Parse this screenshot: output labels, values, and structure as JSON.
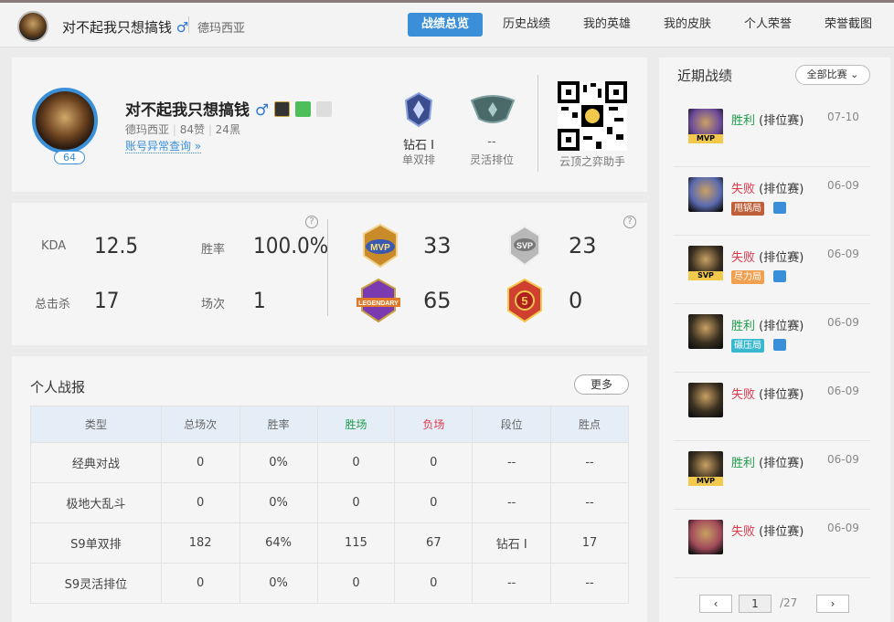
{
  "header": {
    "nickname": "对不起我只想搞钱",
    "gender_symbol": "♂",
    "region": "德玛西亚",
    "tabs": [
      {
        "label": "战绩总览",
        "active": true
      },
      {
        "label": "历史战绩",
        "active": false
      },
      {
        "label": "我的英雄",
        "active": false
      },
      {
        "label": "我的皮肤",
        "active": false
      },
      {
        "label": "个人荣誉",
        "active": false
      },
      {
        "label": "荣誉截图",
        "active": false
      }
    ]
  },
  "profile": {
    "name": "对不起我只想搞钱",
    "gender_symbol": "♂",
    "level": "64",
    "region": "德玛西亚",
    "likes": "84赞",
    "blacks": "24黑",
    "abnormal_link": "账号异常查询 »",
    "solo_rank": "钻石 Ⅰ",
    "solo_label": "单双排",
    "flex_rank": "--",
    "flex_label": "灵活排位",
    "qr_caption": "云顶之弈助手"
  },
  "stats": {
    "kda_label": "KDA",
    "kda": "12.5",
    "winrate_label": "胜率",
    "winrate": "100.0%",
    "kills_label": "总击杀",
    "kills": "17",
    "games_label": "场次",
    "games": "1",
    "mvp_count": "33",
    "svp_count": "23",
    "legendary_count": "65",
    "pentakill_count": "0",
    "help_icon": "?"
  },
  "report": {
    "title": "个人战报",
    "more_label": "更多",
    "headers": [
      "类型",
      "总场次",
      "胜率",
      "胜场",
      "负场",
      "段位",
      "胜点"
    ],
    "rows": [
      [
        "经典对战",
        "0",
        "0%",
        "0",
        "0",
        "--",
        "--"
      ],
      [
        "极地大乱斗",
        "0",
        "0%",
        "0",
        "0",
        "--",
        "--"
      ],
      [
        "S9单双排",
        "182",
        "64%",
        "115",
        "67",
        "钻石 Ⅰ",
        "17"
      ],
      [
        "S9灵活排位",
        "0",
        "0%",
        "0",
        "0",
        "--",
        "--"
      ]
    ]
  },
  "recent": {
    "title": "近期战绩",
    "filter_label": "全部比赛 ⌄",
    "matches": [
      {
        "result": "胜利",
        "type": "(排位赛)",
        "date": "07-10",
        "win": true,
        "badge": "MVP",
        "tag": "",
        "hero_color": "#6b4a9a"
      },
      {
        "result": "失败",
        "type": "(排位赛)",
        "date": "06-09",
        "win": false,
        "badge": "",
        "tag": "甩锅局",
        "tag_color": "#c0603a",
        "hero_color": "#5a6ab0"
      },
      {
        "result": "失败",
        "type": "(排位赛)",
        "date": "06-09",
        "win": false,
        "badge": "SVP",
        "tag": "尽力局",
        "tag_color": "#f0a050",
        "hero_color": "#3a3020"
      },
      {
        "result": "胜利",
        "type": "(排位赛)",
        "date": "06-09",
        "win": true,
        "badge": "",
        "tag": "碾压局",
        "tag_color": "#3ab8d0",
        "hero_color": "#3a3020"
      },
      {
        "result": "失败",
        "type": "(排位赛)",
        "date": "06-09",
        "win": false,
        "badge": "",
        "tag": "",
        "hero_color": "#3a3020"
      },
      {
        "result": "胜利",
        "type": "(排位赛)",
        "date": "06-09",
        "win": true,
        "badge": "MVP",
        "tag": "",
        "hero_color": "#3a3020"
      },
      {
        "result": "失败",
        "type": "(排位赛)",
        "date": "06-09",
        "win": false,
        "badge": "",
        "tag": "",
        "hero_color": "#a04a5a"
      }
    ],
    "pager": {
      "prev": "‹",
      "page": "1",
      "total": "/27",
      "next": "›"
    }
  }
}
